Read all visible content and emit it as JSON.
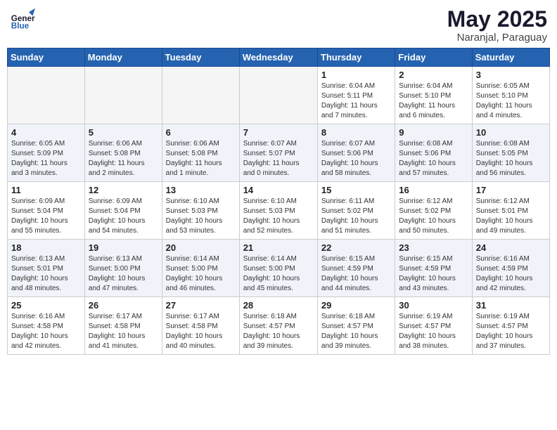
{
  "header": {
    "logo_line1": "General",
    "logo_line2": "Blue",
    "month": "May 2025",
    "location": "Naranjal, Paraguay"
  },
  "weekdays": [
    "Sunday",
    "Monday",
    "Tuesday",
    "Wednesday",
    "Thursday",
    "Friday",
    "Saturday"
  ],
  "weeks": [
    [
      {
        "day": "",
        "info": ""
      },
      {
        "day": "",
        "info": ""
      },
      {
        "day": "",
        "info": ""
      },
      {
        "day": "",
        "info": ""
      },
      {
        "day": "1",
        "info": "Sunrise: 6:04 AM\nSunset: 5:11 PM\nDaylight: 11 hours\nand 7 minutes."
      },
      {
        "day": "2",
        "info": "Sunrise: 6:04 AM\nSunset: 5:10 PM\nDaylight: 11 hours\nand 6 minutes."
      },
      {
        "day": "3",
        "info": "Sunrise: 6:05 AM\nSunset: 5:10 PM\nDaylight: 11 hours\nand 4 minutes."
      }
    ],
    [
      {
        "day": "4",
        "info": "Sunrise: 6:05 AM\nSunset: 5:09 PM\nDaylight: 11 hours\nand 3 minutes."
      },
      {
        "day": "5",
        "info": "Sunrise: 6:06 AM\nSunset: 5:08 PM\nDaylight: 11 hours\nand 2 minutes."
      },
      {
        "day": "6",
        "info": "Sunrise: 6:06 AM\nSunset: 5:08 PM\nDaylight: 11 hours\nand 1 minute."
      },
      {
        "day": "7",
        "info": "Sunrise: 6:07 AM\nSunset: 5:07 PM\nDaylight: 11 hours\nand 0 minutes."
      },
      {
        "day": "8",
        "info": "Sunrise: 6:07 AM\nSunset: 5:06 PM\nDaylight: 10 hours\nand 58 minutes."
      },
      {
        "day": "9",
        "info": "Sunrise: 6:08 AM\nSunset: 5:06 PM\nDaylight: 10 hours\nand 57 minutes."
      },
      {
        "day": "10",
        "info": "Sunrise: 6:08 AM\nSunset: 5:05 PM\nDaylight: 10 hours\nand 56 minutes."
      }
    ],
    [
      {
        "day": "11",
        "info": "Sunrise: 6:09 AM\nSunset: 5:04 PM\nDaylight: 10 hours\nand 55 minutes."
      },
      {
        "day": "12",
        "info": "Sunrise: 6:09 AM\nSunset: 5:04 PM\nDaylight: 10 hours\nand 54 minutes."
      },
      {
        "day": "13",
        "info": "Sunrise: 6:10 AM\nSunset: 5:03 PM\nDaylight: 10 hours\nand 53 minutes."
      },
      {
        "day": "14",
        "info": "Sunrise: 6:10 AM\nSunset: 5:03 PM\nDaylight: 10 hours\nand 52 minutes."
      },
      {
        "day": "15",
        "info": "Sunrise: 6:11 AM\nSunset: 5:02 PM\nDaylight: 10 hours\nand 51 minutes."
      },
      {
        "day": "16",
        "info": "Sunrise: 6:12 AM\nSunset: 5:02 PM\nDaylight: 10 hours\nand 50 minutes."
      },
      {
        "day": "17",
        "info": "Sunrise: 6:12 AM\nSunset: 5:01 PM\nDaylight: 10 hours\nand 49 minutes."
      }
    ],
    [
      {
        "day": "18",
        "info": "Sunrise: 6:13 AM\nSunset: 5:01 PM\nDaylight: 10 hours\nand 48 minutes."
      },
      {
        "day": "19",
        "info": "Sunrise: 6:13 AM\nSunset: 5:00 PM\nDaylight: 10 hours\nand 47 minutes."
      },
      {
        "day": "20",
        "info": "Sunrise: 6:14 AM\nSunset: 5:00 PM\nDaylight: 10 hours\nand 46 minutes."
      },
      {
        "day": "21",
        "info": "Sunrise: 6:14 AM\nSunset: 5:00 PM\nDaylight: 10 hours\nand 45 minutes."
      },
      {
        "day": "22",
        "info": "Sunrise: 6:15 AM\nSunset: 4:59 PM\nDaylight: 10 hours\nand 44 minutes."
      },
      {
        "day": "23",
        "info": "Sunrise: 6:15 AM\nSunset: 4:59 PM\nDaylight: 10 hours\nand 43 minutes."
      },
      {
        "day": "24",
        "info": "Sunrise: 6:16 AM\nSunset: 4:59 PM\nDaylight: 10 hours\nand 42 minutes."
      }
    ],
    [
      {
        "day": "25",
        "info": "Sunrise: 6:16 AM\nSunset: 4:58 PM\nDaylight: 10 hours\nand 42 minutes."
      },
      {
        "day": "26",
        "info": "Sunrise: 6:17 AM\nSunset: 4:58 PM\nDaylight: 10 hours\nand 41 minutes."
      },
      {
        "day": "27",
        "info": "Sunrise: 6:17 AM\nSunset: 4:58 PM\nDaylight: 10 hours\nand 40 minutes."
      },
      {
        "day": "28",
        "info": "Sunrise: 6:18 AM\nSunset: 4:57 PM\nDaylight: 10 hours\nand 39 minutes."
      },
      {
        "day": "29",
        "info": "Sunrise: 6:18 AM\nSunset: 4:57 PM\nDaylight: 10 hours\nand 39 minutes."
      },
      {
        "day": "30",
        "info": "Sunrise: 6:19 AM\nSunset: 4:57 PM\nDaylight: 10 hours\nand 38 minutes."
      },
      {
        "day": "31",
        "info": "Sunrise: 6:19 AM\nSunset: 4:57 PM\nDaylight: 10 hours\nand 37 minutes."
      }
    ]
  ]
}
